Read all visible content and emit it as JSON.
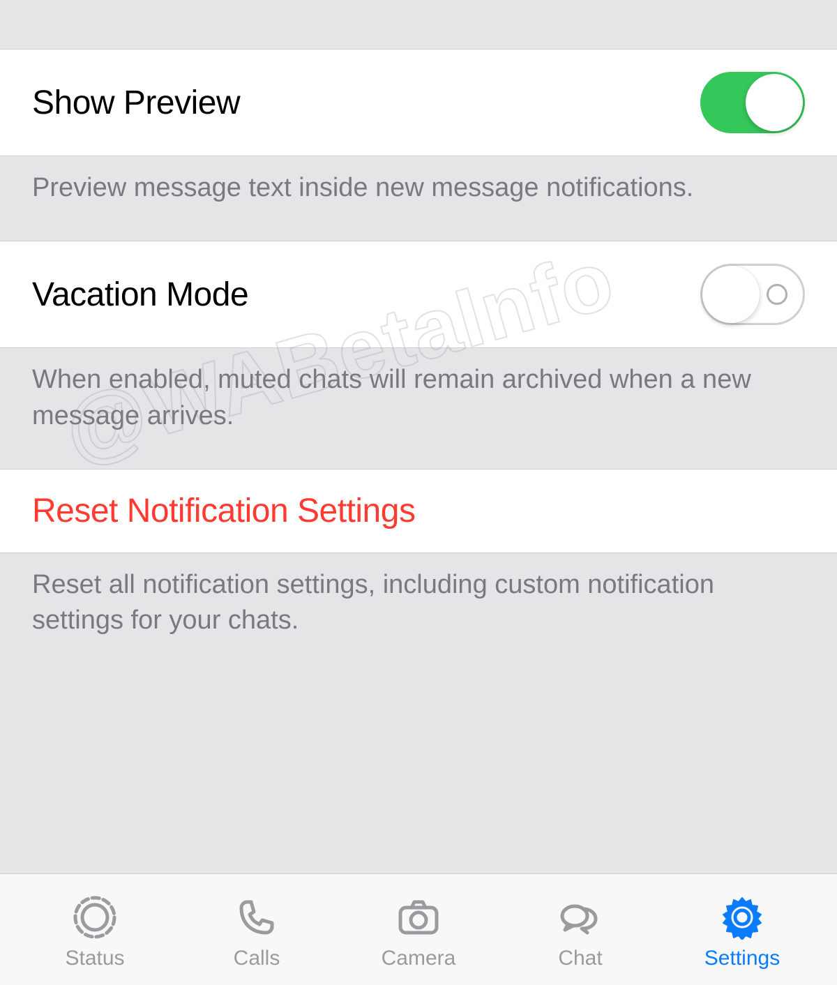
{
  "sections": {
    "show_preview": {
      "label": "Show Preview",
      "enabled": true,
      "footer": "Preview message text inside new message notifications."
    },
    "vacation_mode": {
      "label": "Vacation Mode",
      "enabled": false,
      "footer": "When enabled, muted chats will remain archived when a new message arrives."
    },
    "reset": {
      "label": "Reset Notification Settings",
      "footer": "Reset all notification settings, including custom notification settings for your chats."
    }
  },
  "tabbar": {
    "items": [
      {
        "label": "Status",
        "icon": "status-icon",
        "active": false
      },
      {
        "label": "Calls",
        "icon": "phone-icon",
        "active": false
      },
      {
        "label": "Camera",
        "icon": "camera-icon",
        "active": false
      },
      {
        "label": "Chat",
        "icon": "chat-icon",
        "active": false
      },
      {
        "label": "Settings",
        "icon": "settings-icon",
        "active": true
      }
    ]
  },
  "watermark": "@WABetaInfo"
}
